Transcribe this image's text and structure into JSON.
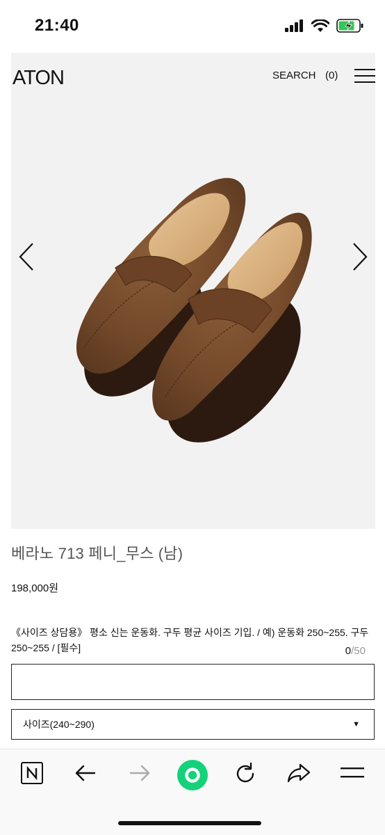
{
  "status_bar": {
    "time": "21:40",
    "icons": [
      "signal-icon",
      "wifi-icon",
      "battery-charging-icon"
    ]
  },
  "header": {
    "logo": "ATON",
    "search_label": "SEARCH",
    "cart_count": "(0)",
    "menu_icon": "hamburger-menu-icon"
  },
  "product": {
    "image_alt": "brown suede penny loafers",
    "name": "베라노 713 페니_무스 (남)",
    "price": "198,000원",
    "option_label": "《사이즈 상담용》 평소 신는 운동화. 구두 평균 사이즈 기입. / 예) 운동화 250~255. 구두250~255 / [필수]",
    "char_count_current": "0",
    "char_count_max": "/50",
    "text_input_value": "",
    "size_select_value": "사이즈(240~290)"
  },
  "browser_toolbar": {
    "icons": [
      "naver-n-icon",
      "back-arrow-icon",
      "forward-arrow-icon",
      "home-green-circle-icon",
      "reload-icon",
      "share-icon",
      "menu-lines-icon"
    ]
  },
  "colors": {
    "image_bg": "#f2f2f2",
    "suede_brown": "#7a4f2e",
    "accent_green": "#13d27a",
    "muted_gray": "#999999"
  }
}
